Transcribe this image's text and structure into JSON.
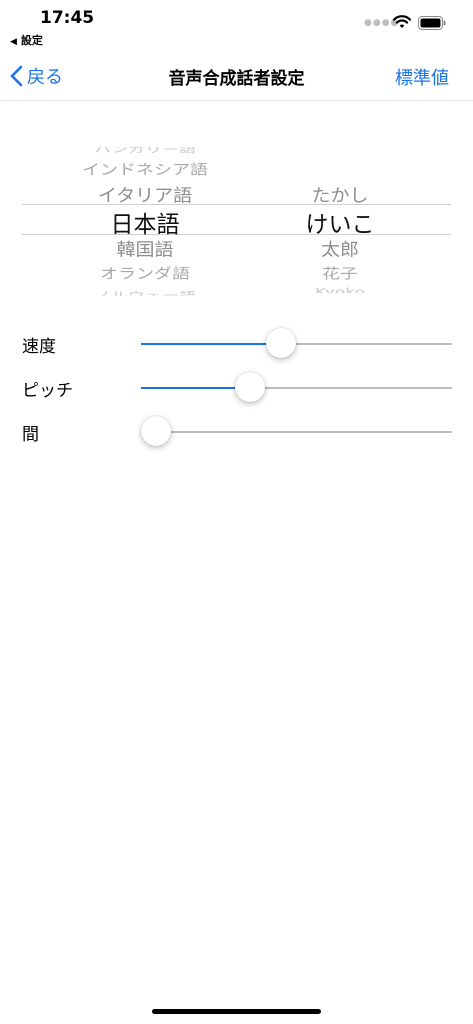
{
  "status_bar": {
    "time": "17:45",
    "back_app": "設定",
    "back_icon": "back-triangle-icon",
    "icons": [
      "signal-dots-icon",
      "wifi-icon",
      "battery-icon"
    ]
  },
  "nav": {
    "back_label": "戻る",
    "title": "音声合成話者設定",
    "right_label": "標準値",
    "accent_color": "#1a73e8"
  },
  "picker": {
    "languages": [
      {
        "label": "ハンガリー語"
      },
      {
        "label": "インドネシア語"
      },
      {
        "label": "イタリア語"
      },
      {
        "label": "日本語",
        "selected": true
      },
      {
        "label": "韓国語"
      },
      {
        "label": "オランダ語"
      },
      {
        "label": "ノルウェー語"
      }
    ],
    "voices": [
      {
        "label": "たかし"
      },
      {
        "label": "けいこ",
        "selected": true
      },
      {
        "label": "太郎"
      },
      {
        "label": "花子"
      },
      {
        "label": "Kyoko"
      }
    ]
  },
  "sliders": [
    {
      "label": "速度",
      "value": 0.45
    },
    {
      "label": "ピッチ",
      "value": 0.35
    },
    {
      "label": "間",
      "value": 0.0
    }
  ]
}
